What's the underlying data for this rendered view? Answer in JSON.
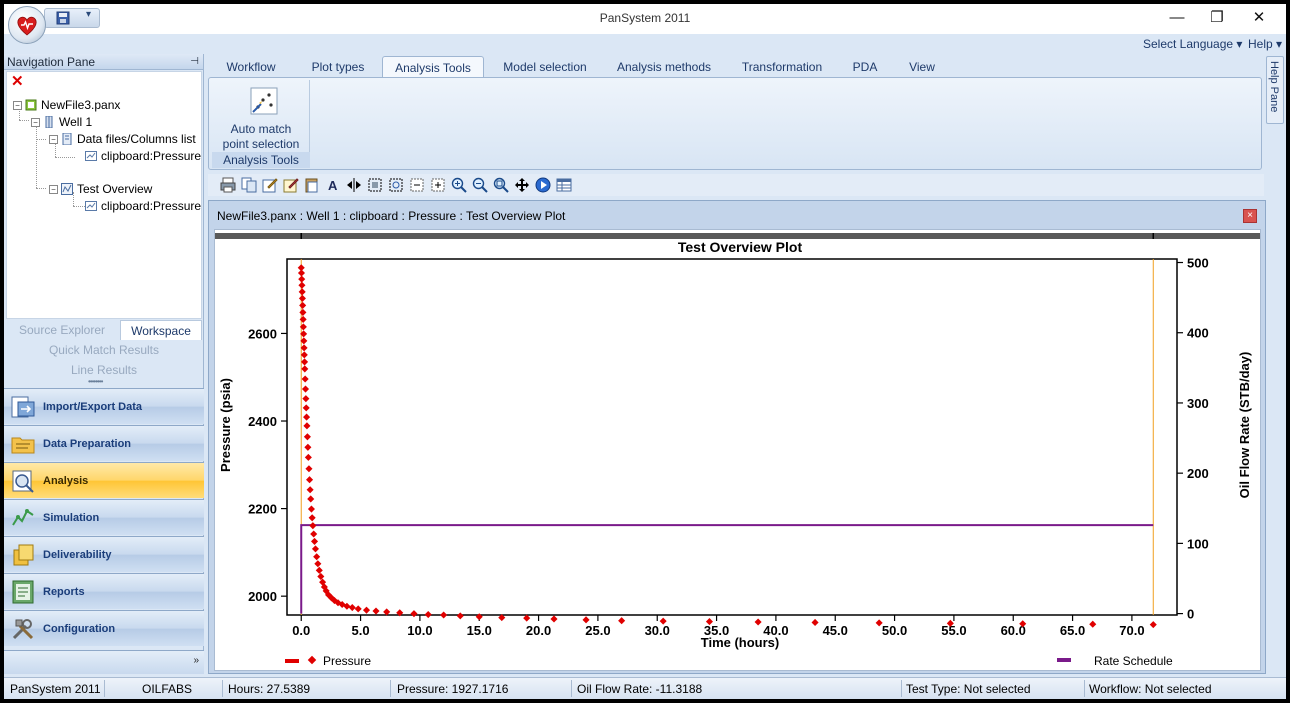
{
  "window": {
    "title": "PanSystem 2011",
    "minimize": "—",
    "restore": "❐",
    "close": "✕"
  },
  "lang": {
    "select_language": "Select Language ▾",
    "help": "Help ▾"
  },
  "nav": {
    "header": "Navigation Pane",
    "pin": "📌",
    "tree": {
      "file": "NewFile3.panx",
      "well": "Well 1",
      "data_files": "Data files/Columns list",
      "clipboard_1": "clipboard:Pressure",
      "test_overview": "Test Overview",
      "clipboard_2": "clipboard:Pressure"
    },
    "tabs": {
      "source_explorer": "Source Explorer",
      "workspace": "Workspace"
    },
    "links": {
      "quick_match": "Quick Match Results",
      "line_results": "Line Results"
    },
    "buttons": [
      {
        "label": "Import/Export Data"
      },
      {
        "label": "Data Preparation"
      },
      {
        "label": "Analysis"
      },
      {
        "label": "Simulation"
      },
      {
        "label": "Deliverability"
      },
      {
        "label": "Reports"
      },
      {
        "label": "Configuration"
      }
    ],
    "more": "»"
  },
  "ribbon": {
    "tabs": [
      {
        "label": "Workflow"
      },
      {
        "label": "Plot types"
      },
      {
        "label": "Analysis Tools",
        "active": true
      },
      {
        "label": "Model selection"
      },
      {
        "label": "Analysis methods"
      },
      {
        "label": "Transformation"
      },
      {
        "label": "PDA"
      },
      {
        "label": "View"
      }
    ],
    "auto_match_label_1": "Auto match",
    "auto_match_label_2": "point selection",
    "group_label": "Analysis Tools"
  },
  "help_pane": "Help Pane",
  "document": {
    "title": "NewFile3.panx : Well 1 : clipboard : Pressure : Test Overview Plot",
    "close": "×"
  },
  "chart_data": {
    "type": "scatter",
    "title": "Test Overview Plot",
    "xlabel": "Time (hours)",
    "ylabel": "Pressure (psia)",
    "y2label": "Oil Flow Rate (STB/day)",
    "xlim": [
      -1.2,
      73.8
    ],
    "ylim": [
      1957,
      2770
    ],
    "y2lim": [
      -2,
      505
    ],
    "x_ticks": [
      0.0,
      5.0,
      10.0,
      15.0,
      20.0,
      25.0,
      30.0,
      35.0,
      40.0,
      45.0,
      50.0,
      55.0,
      60.0,
      65.0,
      70.0
    ],
    "x_tick_labels": [
      "0.0",
      "5.0",
      "10.0",
      "15.0",
      "20.0",
      "25.0",
      "30.0",
      "35.0",
      "40.0",
      "45.0",
      "50.0",
      "55.0",
      "60.0",
      "65.0",
      "70.0"
    ],
    "y_ticks": [
      2000,
      2200,
      2400,
      2600
    ],
    "y_tick_labels": [
      "2000",
      "2200",
      "2400",
      "2600"
    ],
    "y2_ticks": [
      0,
      100,
      200,
      300,
      400,
      500
    ],
    "y2_tick_labels": [
      "0",
      "100",
      "200",
      "300",
      "400",
      "500"
    ],
    "legend_position": "bottom",
    "series": [
      {
        "name": "Pressure",
        "color": "#e00000",
        "marker": "diamond",
        "axis": "left",
        "x": [
          0.0,
          0.02,
          0.04,
          0.06,
          0.08,
          0.1,
          0.12,
          0.14,
          0.16,
          0.18,
          0.2,
          0.22,
          0.24,
          0.26,
          0.28,
          0.3,
          0.33,
          0.36,
          0.39,
          0.42,
          0.45,
          0.48,
          0.52,
          0.56,
          0.6,
          0.65,
          0.7,
          0.75,
          0.8,
          0.86,
          0.92,
          0.98,
          1.05,
          1.12,
          1.2,
          1.3,
          1.4,
          1.52,
          1.65,
          1.8,
          1.95,
          2.1,
          2.3,
          2.55,
          2.8,
          3.1,
          3.45,
          3.85,
          4.3,
          4.8,
          5.5,
          6.3,
          7.2,
          8.3,
          9.5,
          10.7,
          12.0,
          13.4,
          15.0,
          16.9,
          19.0,
          21.3,
          24.0,
          27.0,
          30.5,
          34.4,
          38.5,
          43.3,
          48.7,
          54.7,
          60.8,
          66.7,
          71.8
        ],
        "y": [
          2750,
          2738,
          2724,
          2710,
          2695,
          2680,
          2664,
          2648,
          2632,
          2615,
          2599,
          2583,
          2567,
          2551,
          2535,
          2519,
          2496,
          2473,
          2451,
          2430,
          2409,
          2389,
          2364,
          2340,
          2317,
          2291,
          2266,
          2243,
          2222,
          2199,
          2179,
          2161,
          2142,
          2125,
          2108,
          2090,
          2074,
          2059,
          2045,
          2032,
          2021,
          2012,
          2003,
          1996,
          1990,
          1985,
          1981,
          1977,
          1974,
          1971,
          1968,
          1966,
          1964,
          1962,
          1960,
          1958,
          1957,
          1955,
          1953,
          1951,
          1950,
          1948,
          1946,
          1944,
          1943,
          1942,
          1941,
          1940,
          1939,
          1938,
          1937,
          1936,
          1935
        ]
      },
      {
        "name": "Rate Schedule",
        "color": "#7a1a8a",
        "axis": "right",
        "x": [
          0.0,
          0.0,
          71.8
        ],
        "y": [
          0,
          126,
          126
        ]
      }
    ]
  },
  "status": {
    "app": "PanSystem 2011",
    "company": "OILFABS",
    "hours": "Hours:  27.5389",
    "pressure": "Pressure:  1927.1716",
    "oil_flow": "Oil Flow Rate:  -11.3188",
    "test_type": "Test Type:  Not selected",
    "workflow": "Workflow:  Not selected"
  }
}
